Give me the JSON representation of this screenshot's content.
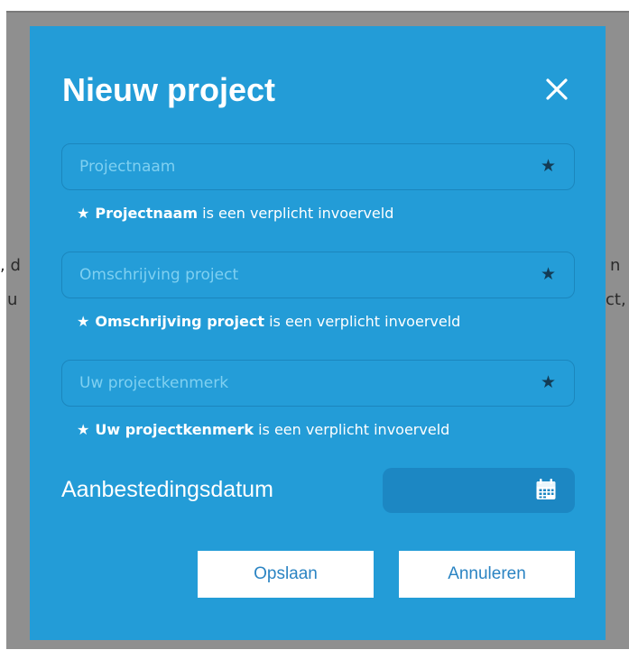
{
  "background": {
    "text_left_1": ", d",
    "text_left_2": "u",
    "text_right_1": "n",
    "text_right_2": "ct,"
  },
  "modal": {
    "title": "Nieuw project",
    "close_icon": "close-icon",
    "fields": [
      {
        "placeholder": "Projectnaam",
        "value": "",
        "required_icon": "star-icon",
        "note_bold": "Projectnaam",
        "note_rest": "is een verplicht invoerveld"
      },
      {
        "placeholder": "Omschrijving project",
        "value": "",
        "required_icon": "star-icon",
        "note_bold": "Omschrijving project",
        "note_rest": "is een verplicht invoerveld"
      },
      {
        "placeholder": "Uw projectkenmerk",
        "value": "",
        "required_icon": "star-icon",
        "note_bold": "Uw projectkenmerk",
        "note_rest": "is een verplicht invoerveld"
      }
    ],
    "date": {
      "label": "Aanbestedingsdatum",
      "value": "",
      "icon": "calendar-icon"
    },
    "buttons": {
      "save": "Opslaan",
      "cancel": "Annuleren"
    }
  },
  "colors": {
    "modal_bg": "#239cd7",
    "overlay": "#8f8f8f",
    "button_text": "#2b84c3",
    "placeholder": "#7fd0f1",
    "date_field_bg": "#1c87c3"
  }
}
